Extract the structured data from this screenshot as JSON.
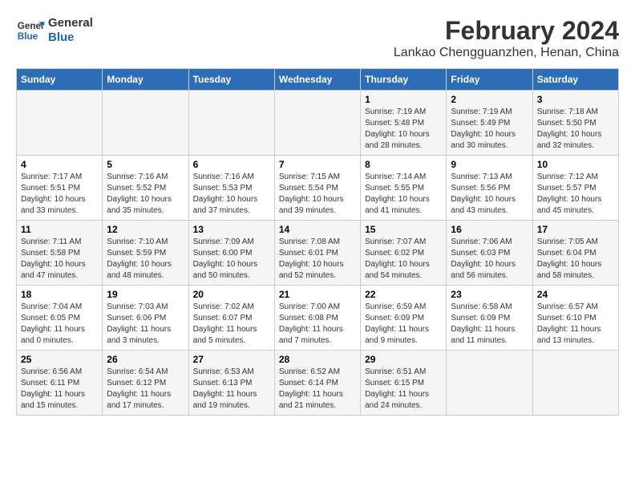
{
  "header": {
    "logo_line1": "General",
    "logo_line2": "Blue",
    "main_title": "February 2024",
    "subtitle": "Lankao Chengguanzhen, Henan, China"
  },
  "days_of_week": [
    "Sunday",
    "Monday",
    "Tuesday",
    "Wednesday",
    "Thursday",
    "Friday",
    "Saturday"
  ],
  "weeks": [
    [
      {
        "day": "",
        "info": ""
      },
      {
        "day": "",
        "info": ""
      },
      {
        "day": "",
        "info": ""
      },
      {
        "day": "",
        "info": ""
      },
      {
        "day": "1",
        "info": "Sunrise: 7:19 AM\nSunset: 5:48 PM\nDaylight: 10 hours and 28 minutes."
      },
      {
        "day": "2",
        "info": "Sunrise: 7:19 AM\nSunset: 5:49 PM\nDaylight: 10 hours and 30 minutes."
      },
      {
        "day": "3",
        "info": "Sunrise: 7:18 AM\nSunset: 5:50 PM\nDaylight: 10 hours and 32 minutes."
      }
    ],
    [
      {
        "day": "4",
        "info": "Sunrise: 7:17 AM\nSunset: 5:51 PM\nDaylight: 10 hours and 33 minutes."
      },
      {
        "day": "5",
        "info": "Sunrise: 7:16 AM\nSunset: 5:52 PM\nDaylight: 10 hours and 35 minutes."
      },
      {
        "day": "6",
        "info": "Sunrise: 7:16 AM\nSunset: 5:53 PM\nDaylight: 10 hours and 37 minutes."
      },
      {
        "day": "7",
        "info": "Sunrise: 7:15 AM\nSunset: 5:54 PM\nDaylight: 10 hours and 39 minutes."
      },
      {
        "day": "8",
        "info": "Sunrise: 7:14 AM\nSunset: 5:55 PM\nDaylight: 10 hours and 41 minutes."
      },
      {
        "day": "9",
        "info": "Sunrise: 7:13 AM\nSunset: 5:56 PM\nDaylight: 10 hours and 43 minutes."
      },
      {
        "day": "10",
        "info": "Sunrise: 7:12 AM\nSunset: 5:57 PM\nDaylight: 10 hours and 45 minutes."
      }
    ],
    [
      {
        "day": "11",
        "info": "Sunrise: 7:11 AM\nSunset: 5:58 PM\nDaylight: 10 hours and 47 minutes."
      },
      {
        "day": "12",
        "info": "Sunrise: 7:10 AM\nSunset: 5:59 PM\nDaylight: 10 hours and 48 minutes."
      },
      {
        "day": "13",
        "info": "Sunrise: 7:09 AM\nSunset: 6:00 PM\nDaylight: 10 hours and 50 minutes."
      },
      {
        "day": "14",
        "info": "Sunrise: 7:08 AM\nSunset: 6:01 PM\nDaylight: 10 hours and 52 minutes."
      },
      {
        "day": "15",
        "info": "Sunrise: 7:07 AM\nSunset: 6:02 PM\nDaylight: 10 hours and 54 minutes."
      },
      {
        "day": "16",
        "info": "Sunrise: 7:06 AM\nSunset: 6:03 PM\nDaylight: 10 hours and 56 minutes."
      },
      {
        "day": "17",
        "info": "Sunrise: 7:05 AM\nSunset: 6:04 PM\nDaylight: 10 hours and 58 minutes."
      }
    ],
    [
      {
        "day": "18",
        "info": "Sunrise: 7:04 AM\nSunset: 6:05 PM\nDaylight: 11 hours and 0 minutes."
      },
      {
        "day": "19",
        "info": "Sunrise: 7:03 AM\nSunset: 6:06 PM\nDaylight: 11 hours and 3 minutes."
      },
      {
        "day": "20",
        "info": "Sunrise: 7:02 AM\nSunset: 6:07 PM\nDaylight: 11 hours and 5 minutes."
      },
      {
        "day": "21",
        "info": "Sunrise: 7:00 AM\nSunset: 6:08 PM\nDaylight: 11 hours and 7 minutes."
      },
      {
        "day": "22",
        "info": "Sunrise: 6:59 AM\nSunset: 6:09 PM\nDaylight: 11 hours and 9 minutes."
      },
      {
        "day": "23",
        "info": "Sunrise: 6:58 AM\nSunset: 6:09 PM\nDaylight: 11 hours and 11 minutes."
      },
      {
        "day": "24",
        "info": "Sunrise: 6:57 AM\nSunset: 6:10 PM\nDaylight: 11 hours and 13 minutes."
      }
    ],
    [
      {
        "day": "25",
        "info": "Sunrise: 6:56 AM\nSunset: 6:11 PM\nDaylight: 11 hours and 15 minutes."
      },
      {
        "day": "26",
        "info": "Sunrise: 6:54 AM\nSunset: 6:12 PM\nDaylight: 11 hours and 17 minutes."
      },
      {
        "day": "27",
        "info": "Sunrise: 6:53 AM\nSunset: 6:13 PM\nDaylight: 11 hours and 19 minutes."
      },
      {
        "day": "28",
        "info": "Sunrise: 6:52 AM\nSunset: 6:14 PM\nDaylight: 11 hours and 21 minutes."
      },
      {
        "day": "29",
        "info": "Sunrise: 6:51 AM\nSunset: 6:15 PM\nDaylight: 11 hours and 24 minutes."
      },
      {
        "day": "",
        "info": ""
      },
      {
        "day": "",
        "info": ""
      }
    ]
  ]
}
